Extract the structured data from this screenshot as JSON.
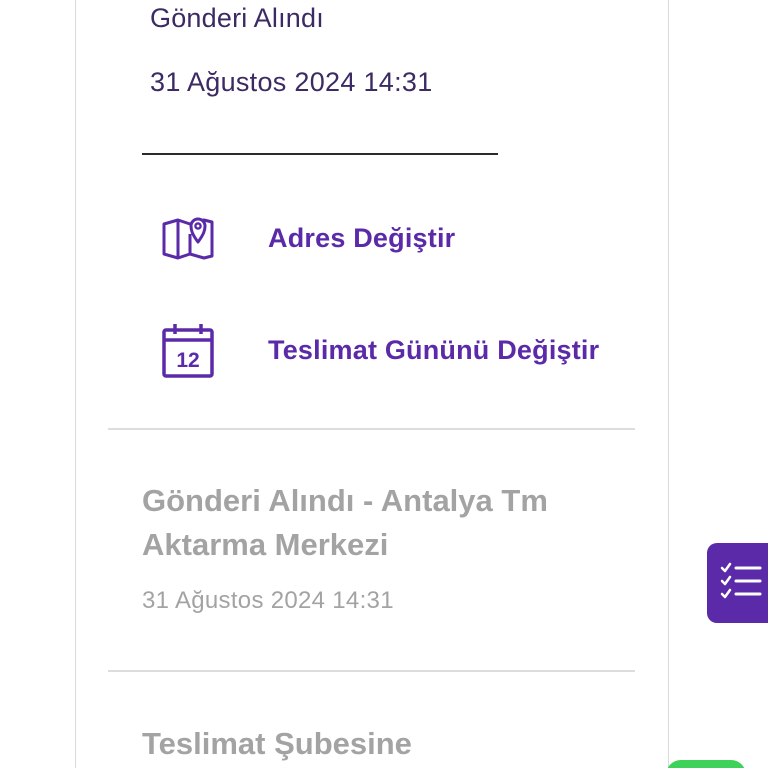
{
  "status": {
    "title": "Gönderi Alındı",
    "date": "31 Ağustos 2024 14:31"
  },
  "actions": [
    {
      "label": "Adres Değiştir",
      "icon": "map-pin-icon"
    },
    {
      "label": "Teslimat Gününü Değiştir",
      "icon": "calendar-icon",
      "icon_text": "12"
    }
  ],
  "history": [
    {
      "title": "Gönderi Alındı - Antalya Tm Aktarma Merkezi",
      "date": "31 Ağustos 2024 14:31"
    },
    {
      "title": "Teslimat Şubesine",
      "date": ""
    }
  ],
  "fab": {
    "icon": "checklist-icon"
  },
  "colors": {
    "accent": "#5a2aa8",
    "status_text": "#3b2a63",
    "muted": "#a3a3a3",
    "divider": "#dddddd",
    "green": "#3fd25a"
  }
}
